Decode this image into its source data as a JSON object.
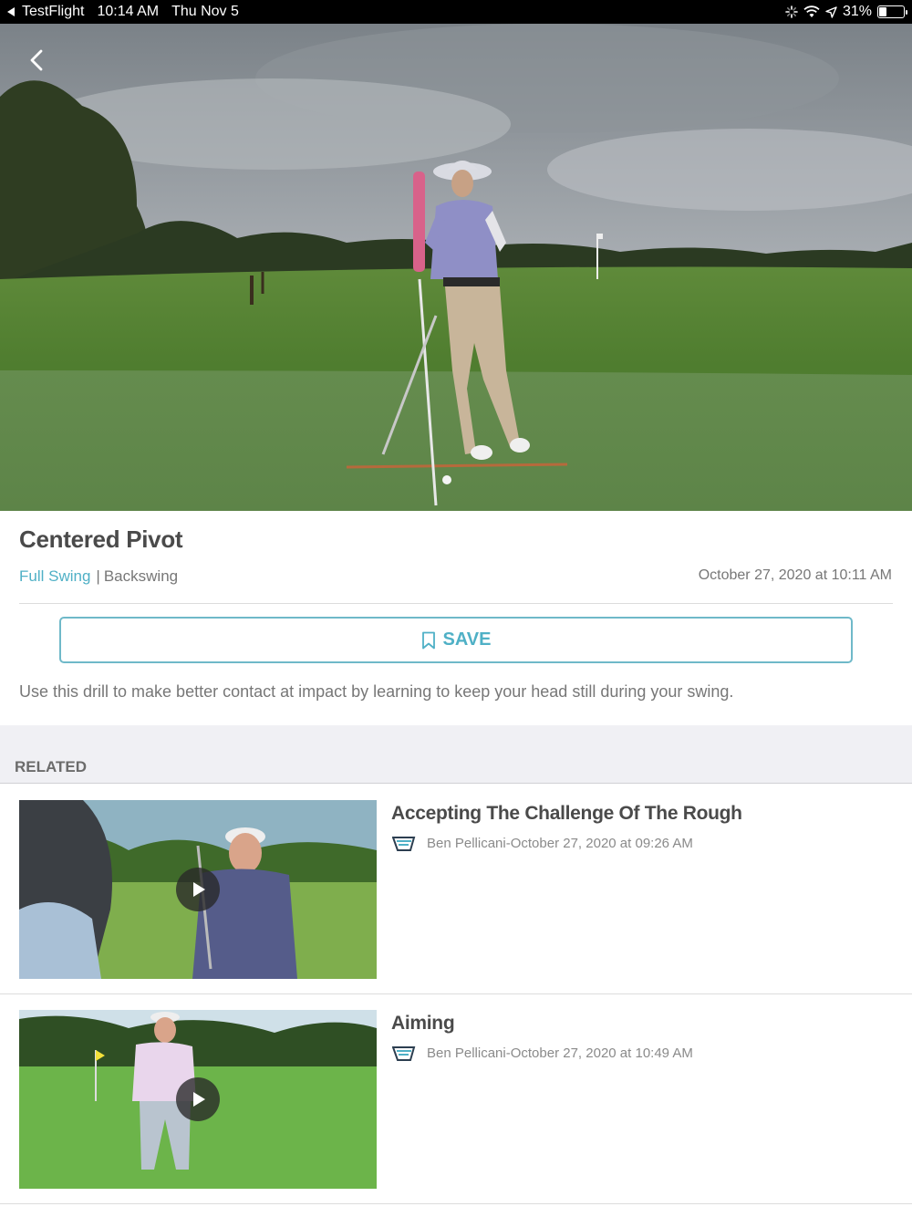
{
  "status_bar": {
    "app": "TestFlight",
    "time": "10:14 AM",
    "date": "Thu Nov 5",
    "battery": "31%",
    "battery_level": 0.31
  },
  "video": {
    "back_icon": "chevron-left-icon"
  },
  "drill": {
    "title": "Centered Pivot",
    "category": "Full Swing",
    "subcategory": "Backswing",
    "date": "October 27, 2020 at 10:11 AM",
    "save_label": "SAVE",
    "save_icon": "bookmark-icon",
    "description": "Use this drill to make better contact at impact by learning to keep your head still during your swing.",
    "accent": "#4fb0c6"
  },
  "related": {
    "header": "RELATED",
    "items": [
      {
        "title": "Accepting The Challenge Of The Rough",
        "meta": "Ben Pellicani-October 27, 2020 at 09:26 AM"
      },
      {
        "title": "Aiming",
        "meta": "Ben Pellicani-October 27, 2020 at 10:49 AM"
      }
    ]
  }
}
